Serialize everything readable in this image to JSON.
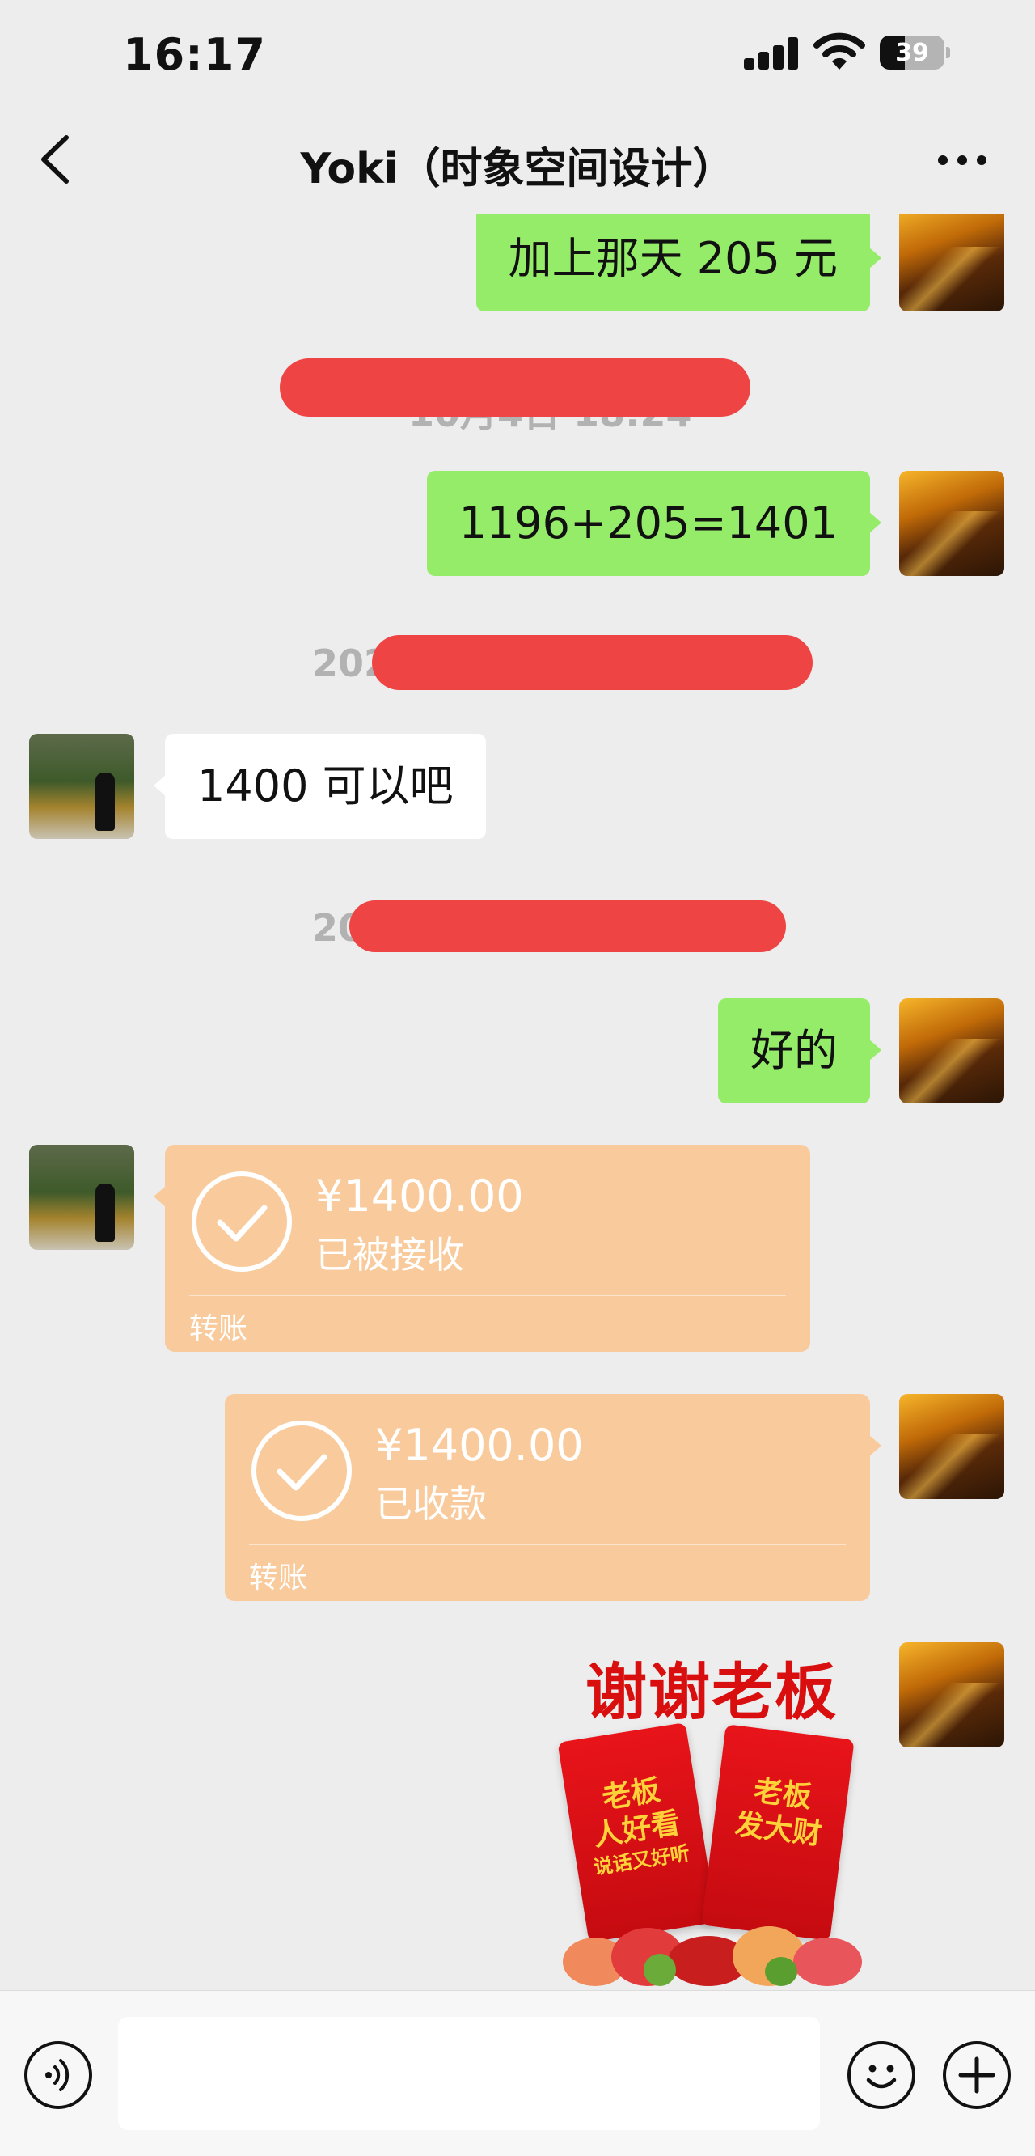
{
  "status_bar": {
    "time": "16:17",
    "battery": "39",
    "battery_level": 0.39
  },
  "nav": {
    "title": "Yoki（时象空间设计）",
    "back_icon": "chevron-left-icon",
    "more_icon": "ellipsis-icon"
  },
  "messages": [
    {
      "side": "right",
      "type": "text",
      "text": "加上那天 205 元"
    },
    {
      "type": "timestamp",
      "text": "10月4日 18:24",
      "redacted": true
    },
    {
      "side": "right",
      "type": "text",
      "text": "1196+205=1401"
    },
    {
      "type": "timestamp",
      "text": "202",
      "redacted": true
    },
    {
      "side": "left",
      "type": "text",
      "text": "1400 可以吧"
    },
    {
      "type": "timestamp",
      "text": "20",
      "redacted": true
    },
    {
      "side": "right",
      "type": "text",
      "text": "好的"
    },
    {
      "side": "left",
      "type": "transfer",
      "amount": "¥1400.00",
      "status": "已被接收",
      "label": "转账"
    },
    {
      "side": "right",
      "type": "transfer",
      "amount": "¥1400.00",
      "status": "已收款",
      "label": "转账"
    },
    {
      "side": "right",
      "type": "sticker",
      "title": "谢谢老板",
      "packet_left": [
        "老板",
        "人好看",
        "说话又好听"
      ],
      "packet_right": [
        "老板",
        "发大财"
      ]
    }
  ],
  "input_bar": {
    "placeholder": "",
    "voice_icon": "voice-icon",
    "emoji_icon": "emoji-icon",
    "plus_icon": "plus-icon"
  },
  "colors": {
    "chat_bg": "#ededed",
    "self_bubble": "#95ec69",
    "other_bubble": "#ffffff",
    "transfer": "#f9cb9c",
    "redact": "#ef4444"
  }
}
